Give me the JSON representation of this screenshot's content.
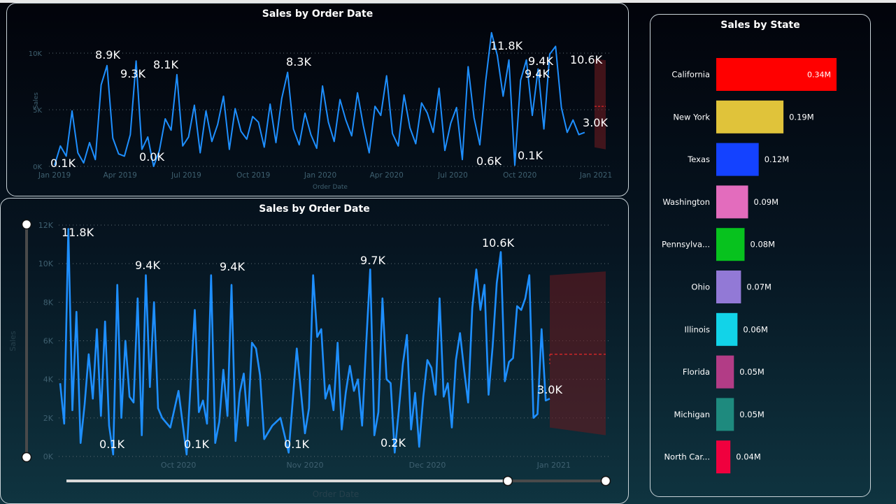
{
  "colors": {
    "line": "#1e8fff",
    "forecast_band": "#6b1a1f",
    "forecast_line": "#ff2a2a",
    "axis_text": "#3f6070",
    "gridline": "#5c6b73"
  },
  "panel_top": {
    "title": "Sales by Order Date",
    "ylabel": "Sales",
    "xlabel": "Order Date"
  },
  "panel_bottom": {
    "title": "Sales by Order Date",
    "ylabel": "Sales",
    "xlabel": "Order Date"
  },
  "panel_right": {
    "title": "Sales by State"
  },
  "chart_data": [
    {
      "type": "line",
      "title": "Sales by Order Date",
      "xlabel": "Order Date",
      "ylabel": "Sales",
      "ylim": [
        0,
        10000
      ],
      "y_ticks": [
        "0K",
        "5K",
        "10K"
      ],
      "x_ticks": [
        "Jan 2019",
        "Apr 2019",
        "Jul 2019",
        "Oct 2019",
        "Jan 2020",
        "Apr 2020",
        "Jul 2020",
        "Oct 2020",
        "Jan 2021"
      ],
      "data_labels": [
        "0.1K",
        "8.9K",
        "9.3K",
        "0.0K",
        "8.1K",
        "8.3K",
        "0.6K",
        "11.8K",
        "0.1K",
        "9.4K",
        "9.4K",
        "10.6K",
        "3.0K"
      ],
      "x": [
        "2019-01-01",
        "2019-01-09",
        "2019-01-17",
        "2019-01-25",
        "2019-02-02",
        "2019-02-10",
        "2019-02-18",
        "2019-02-26",
        "2019-03-06",
        "2019-03-14",
        "2019-03-22",
        "2019-03-30",
        "2019-04-07",
        "2019-04-15",
        "2019-04-23",
        "2019-05-01",
        "2019-05-09",
        "2019-05-17",
        "2019-05-25",
        "2019-06-02",
        "2019-06-10",
        "2019-06-18",
        "2019-06-26",
        "2019-07-04",
        "2019-07-12",
        "2019-07-20",
        "2019-07-28",
        "2019-08-05",
        "2019-08-13",
        "2019-08-21",
        "2019-08-29",
        "2019-09-06",
        "2019-09-14",
        "2019-09-22",
        "2019-09-30",
        "2019-10-08",
        "2019-10-16",
        "2019-10-24",
        "2019-11-01",
        "2019-11-09",
        "2019-11-17",
        "2019-11-25",
        "2019-12-03",
        "2019-12-11",
        "2019-12-19",
        "2019-12-27",
        "2020-01-04",
        "2020-01-12",
        "2020-01-20",
        "2020-01-28",
        "2020-02-05",
        "2020-02-13",
        "2020-02-21",
        "2020-02-29",
        "2020-03-08",
        "2020-03-16",
        "2020-03-24",
        "2020-04-01",
        "2020-04-09",
        "2020-04-17",
        "2020-04-25",
        "2020-05-03",
        "2020-05-11",
        "2020-05-19",
        "2020-05-27",
        "2020-06-04",
        "2020-06-12",
        "2020-06-20",
        "2020-06-28",
        "2020-07-06",
        "2020-07-14",
        "2020-07-22",
        "2020-07-30",
        "2020-08-07",
        "2020-08-15",
        "2020-08-23",
        "2020-08-31",
        "2020-09-08",
        "2020-09-16",
        "2020-09-24",
        "2020-10-02",
        "2020-10-10",
        "2020-10-18",
        "2020-10-26",
        "2020-11-03",
        "2020-11-11",
        "2020-11-19",
        "2020-11-27",
        "2020-12-05",
        "2020-12-13",
        "2020-12-21",
        "2020-12-29"
      ],
      "y": [
        100,
        1800,
        900,
        4900,
        1200,
        300,
        2100,
        600,
        7200,
        8900,
        2500,
        1100,
        900,
        2800,
        9300,
        1500,
        2600,
        0,
        1400,
        4200,
        3200,
        8100,
        1800,
        2600,
        5400,
        1200,
        4900,
        2200,
        3700,
        6200,
        1500,
        5100,
        3100,
        2400,
        4400,
        3900,
        1700,
        5500,
        2100,
        6000,
        8300,
        3300,
        1900,
        4700,
        2800,
        1600,
        7100,
        3900,
        2200,
        5900,
        4100,
        2700,
        6500,
        3600,
        1200,
        5300,
        4500,
        8000,
        2900,
        1800,
        6300,
        3400,
        2000,
        5600,
        4700,
        3000,
        6900,
        1400,
        3800,
        5200,
        600,
        8800,
        4300,
        1900,
        7500,
        11800,
        9800,
        6200,
        9400,
        100,
        7600,
        9400,
        4500,
        8600,
        3300,
        9900,
        10600,
        5200,
        3000,
        4100,
        2800,
        3000
      ],
      "forecast": {
        "lower": 1500,
        "upper": 9500,
        "mid": 5300
      }
    },
    {
      "type": "line",
      "title": "Sales by Order Date",
      "xlabel": "Order Date",
      "ylabel": "Sales",
      "ylim": [
        0,
        12000
      ],
      "y_ticks": [
        "0K",
        "2K",
        "4K",
        "6K",
        "8K",
        "10K",
        "12K"
      ],
      "x_ticks": [
        "Oct 2020",
        "Nov 2020",
        "Dec 2020",
        "Jan 2021"
      ],
      "data_labels": [
        "11.8K",
        "9.4K",
        "9.4K",
        "9.7K",
        "10.6K",
        "0.1K",
        "0.1K",
        "0.1K",
        "0.2K",
        "3.0K"
      ],
      "x": [
        "2020-09-02",
        "2020-09-03",
        "2020-09-04",
        "2020-09-05",
        "2020-09-06",
        "2020-09-07",
        "2020-09-08",
        "2020-09-09",
        "2020-09-10",
        "2020-09-11",
        "2020-09-12",
        "2020-09-13",
        "2020-09-14",
        "2020-09-15",
        "2020-09-16",
        "2020-09-17",
        "2020-09-18",
        "2020-09-19",
        "2020-09-20",
        "2020-09-21",
        "2020-09-22",
        "2020-09-23",
        "2020-09-24",
        "2020-09-25",
        "2020-09-26",
        "2020-09-27",
        "2020-09-29",
        "2020-10-01",
        "2020-10-03",
        "2020-10-05",
        "2020-10-06",
        "2020-10-07",
        "2020-10-08",
        "2020-10-09",
        "2020-10-10",
        "2020-10-11",
        "2020-10-12",
        "2020-10-13",
        "2020-10-14",
        "2020-10-15",
        "2020-10-16",
        "2020-10-17",
        "2020-10-18",
        "2020-10-19",
        "2020-10-20",
        "2020-10-21",
        "2020-10-22",
        "2020-10-24",
        "2020-10-26",
        "2020-10-28",
        "2020-10-30",
        "2020-11-01",
        "2020-11-02",
        "2020-11-03",
        "2020-11-04",
        "2020-11-05",
        "2020-11-06",
        "2020-11-07",
        "2020-11-08",
        "2020-11-09",
        "2020-11-10",
        "2020-11-11",
        "2020-11-12",
        "2020-11-13",
        "2020-11-14",
        "2020-11-15",
        "2020-11-16",
        "2020-11-17",
        "2020-11-18",
        "2020-11-19",
        "2020-11-20",
        "2020-11-21",
        "2020-11-22",
        "2020-11-23",
        "2020-11-24",
        "2020-11-25",
        "2020-11-26",
        "2020-11-27",
        "2020-11-28",
        "2020-11-29",
        "2020-11-30",
        "2020-12-01",
        "2020-12-02",
        "2020-12-03",
        "2020-12-04",
        "2020-12-05",
        "2020-12-06",
        "2020-12-07",
        "2020-12-08",
        "2020-12-09",
        "2020-12-10",
        "2020-12-11",
        "2020-12-12",
        "2020-12-13",
        "2020-12-14",
        "2020-12-15",
        "2020-12-16",
        "2020-12-17",
        "2020-12-18",
        "2020-12-19",
        "2020-12-20",
        "2020-12-21",
        "2020-12-22",
        "2020-12-23",
        "2020-12-24",
        "2020-12-25",
        "2020-12-26",
        "2020-12-27",
        "2020-12-28",
        "2020-12-29",
        "2020-12-30",
        "2020-12-31"
      ],
      "y": [
        3800,
        1700,
        11800,
        2400,
        7500,
        700,
        2700,
        5300,
        3000,
        6600,
        2100,
        7000,
        1600,
        100,
        8900,
        2000,
        6000,
        3100,
        2800,
        8200,
        1100,
        9400,
        3600,
        8000,
        2500,
        2000,
        1500,
        3400,
        100,
        7600,
        2300,
        2900,
        1700,
        9400,
        700,
        1800,
        4500,
        2100,
        8900,
        800,
        3300,
        4300,
        1600,
        5900,
        5600,
        4200,
        900,
        1600,
        2000,
        200,
        5600,
        1200,
        2500,
        9400,
        6200,
        6600,
        3000,
        3700,
        2400,
        5900,
        1400,
        3300,
        4700,
        3400,
        4000,
        1600,
        5800,
        9700,
        1100,
        2300,
        8200,
        4000,
        3800,
        200,
        2400,
        4800,
        6300,
        1400,
        3300,
        500,
        3100,
        5000,
        4600,
        3200,
        8200,
        3100,
        3800,
        1500,
        5000,
        6400,
        4500,
        2800,
        7700,
        9700,
        7600,
        8900,
        3200,
        5700,
        9000,
        10600,
        3900,
        4900,
        5100,
        7800,
        7600,
        8200,
        9400,
        2000,
        2200,
        6600,
        2900,
        3000
      ],
      "forecast": {
        "lower_start": 1500,
        "lower_end": 1100,
        "upper_start": 9400,
        "upper_end": 9600,
        "mid": 5300
      }
    },
    {
      "type": "bar",
      "title": "Sales by State",
      "categories": [
        "California",
        "New York",
        "Texas",
        "Washington",
        "Pennsylva...",
        "Ohio",
        "Illinois",
        "Florida",
        "Michigan",
        "North Car..."
      ],
      "values": [
        0.34,
        0.19,
        0.12,
        0.09,
        0.08,
        0.07,
        0.06,
        0.05,
        0.05,
        0.04
      ],
      "value_labels": [
        "0.34M",
        "0.19M",
        "0.12M",
        "0.09M",
        "0.08M",
        "0.07M",
        "0.06M",
        "0.05M",
        "0.05M",
        "0.04M"
      ],
      "colors": [
        "#ff0000",
        "#e0c33a",
        "#1442ff",
        "#e36cbd",
        "#07c21e",
        "#9279d6",
        "#12d3e8",
        "#b23c86",
        "#1e8a7e",
        "#f0003e"
      ],
      "unit": "M"
    }
  ]
}
